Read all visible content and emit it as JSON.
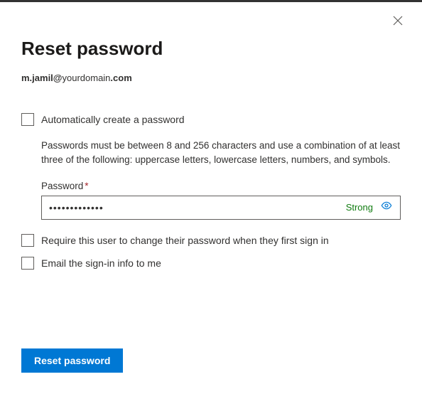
{
  "title": "Reset password",
  "email": {
    "prefix": "m.jamil@",
    "domain": "yourdomain",
    "suffix": ".com"
  },
  "auto_create": {
    "label": "Automatically create a password",
    "checked": false
  },
  "hint": "Passwords must be between 8 and 256 characters and use a combination of at least three of the following: uppercase letters, lowercase letters, numbers, and symbols.",
  "password": {
    "label": "Password",
    "required": "*",
    "value": "•••••••••••••",
    "strength": "Strong"
  },
  "require_change": {
    "label": "Require this user to change their password when they first sign in",
    "checked": false
  },
  "email_info": {
    "label": "Email the sign-in info to me",
    "checked": false
  },
  "submit_label": "Reset password"
}
